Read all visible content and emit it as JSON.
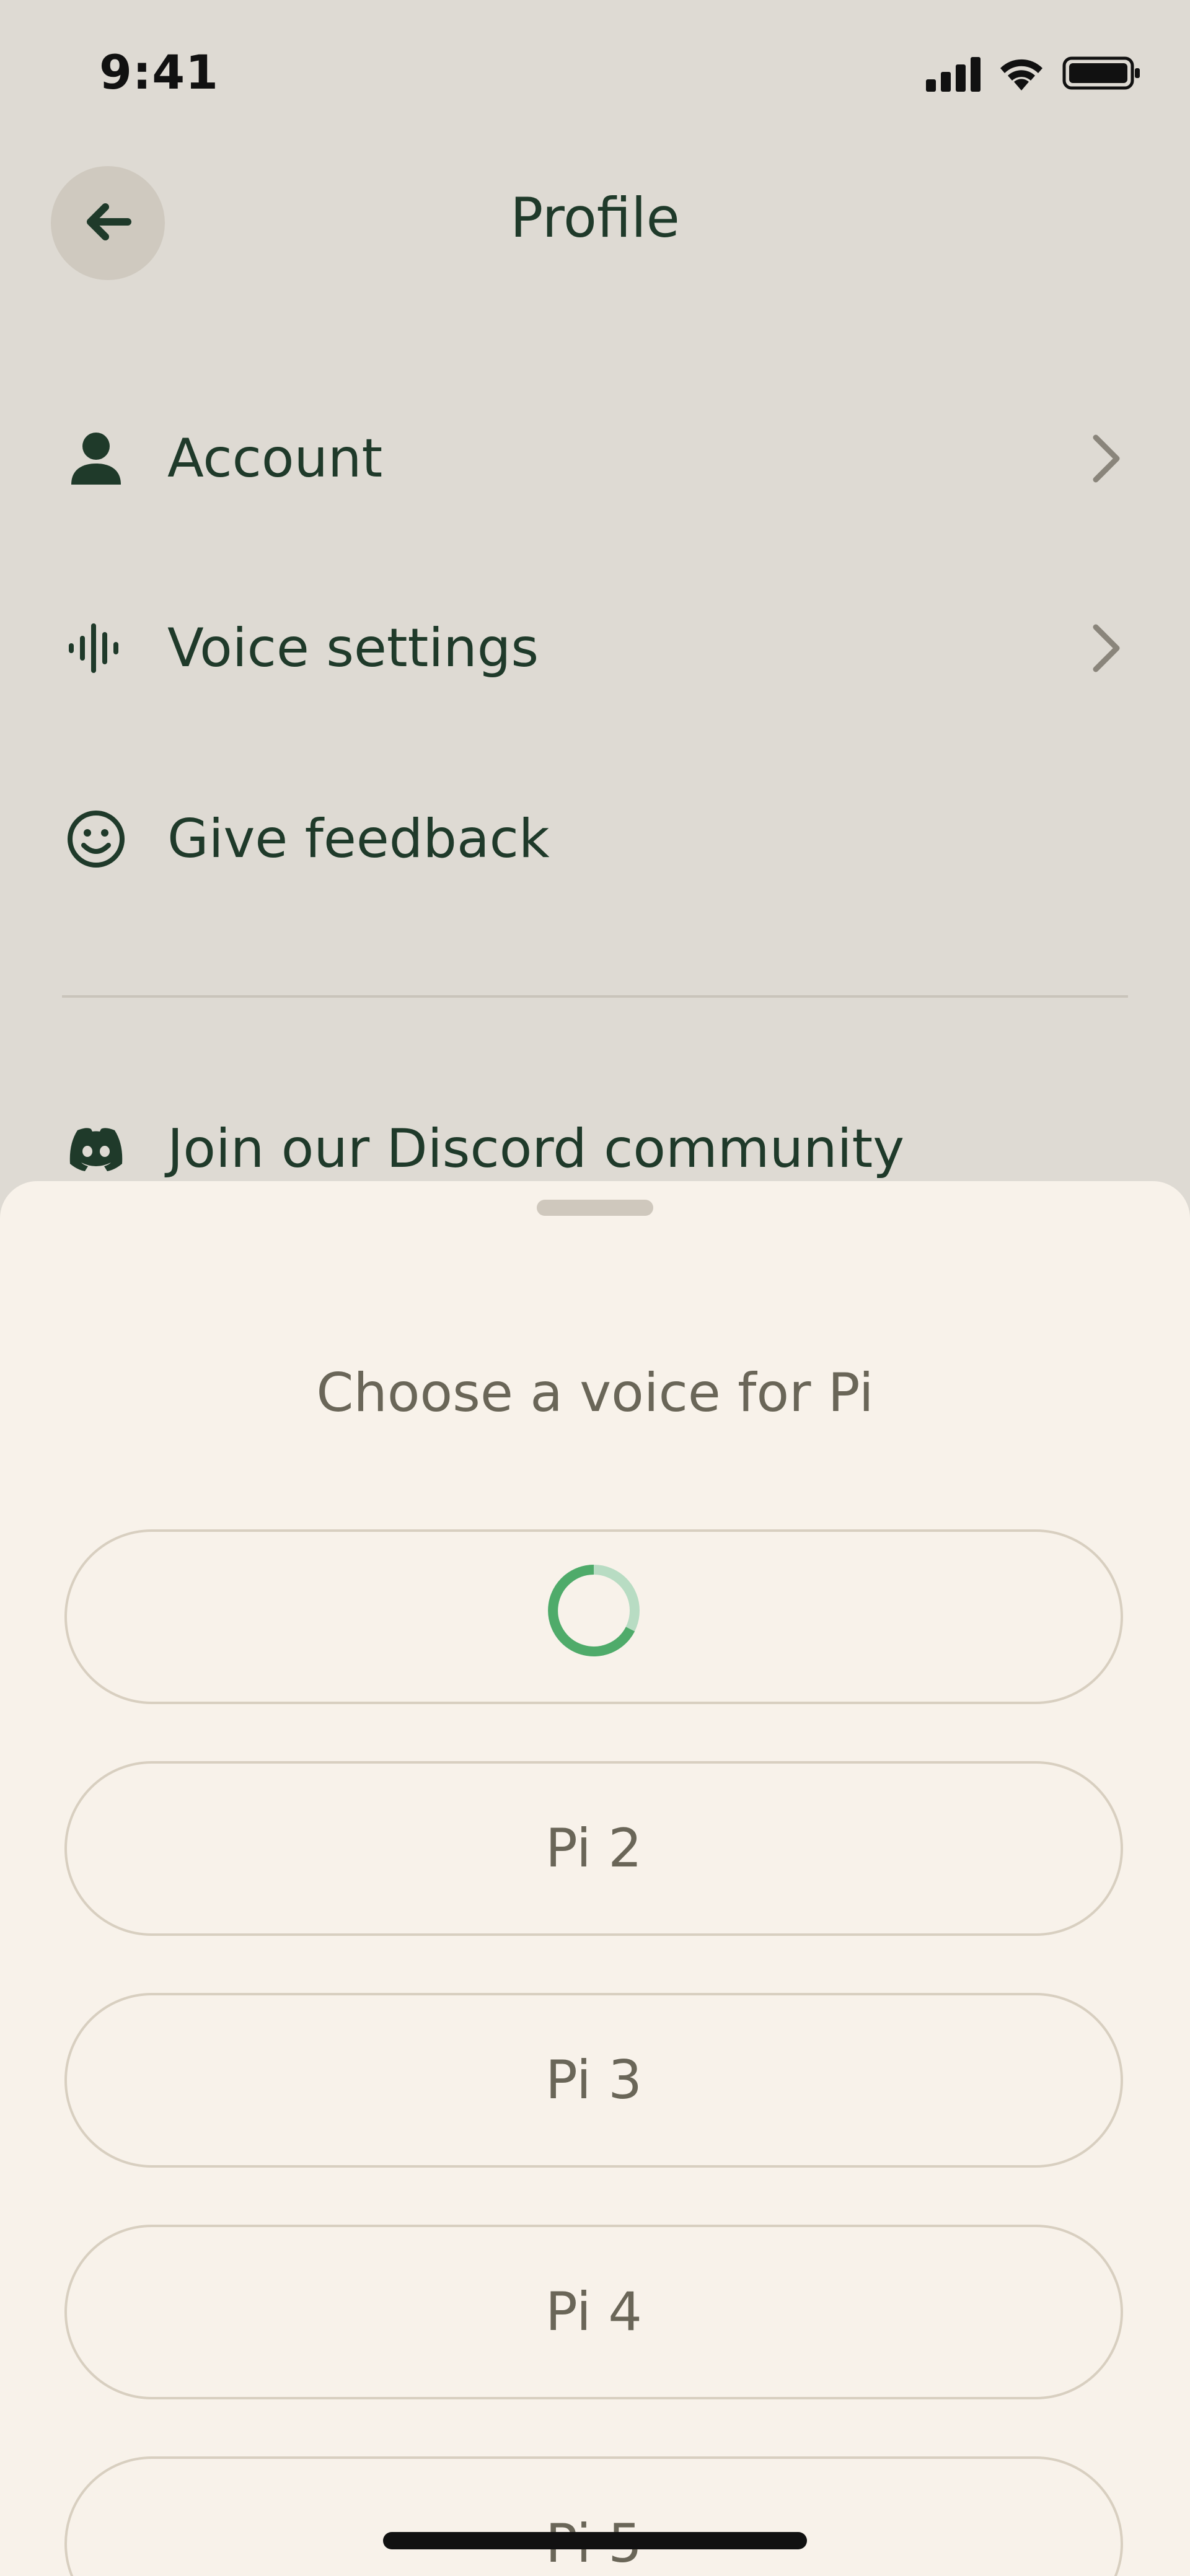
{
  "status_bar": {
    "time": "9:41"
  },
  "header": {
    "title": "Profile",
    "back_icon": "arrow-left-icon"
  },
  "menu": {
    "items": [
      {
        "label": "Account",
        "icon": "person-icon",
        "has_chevron": true
      },
      {
        "label": "Voice settings",
        "icon": "audio-waveform-icon",
        "has_chevron": true
      },
      {
        "label": "Give feedback",
        "icon": "smiley-icon",
        "has_chevron": false
      },
      {
        "label": "Join our Discord community",
        "icon": "discord-icon",
        "has_chevron": false
      }
    ]
  },
  "sheet": {
    "title": "Choose a voice for Pi",
    "options": [
      {
        "label": "",
        "state": "loading"
      },
      {
        "label": "Pi 2"
      },
      {
        "label": "Pi 3"
      },
      {
        "label": "Pi 4"
      },
      {
        "label": "Pi 5"
      }
    ]
  },
  "colors": {
    "background": "#dedad3",
    "sheet_background": "#f8f2ea",
    "text_primary": "#1f3a2a",
    "text_secondary": "#6a6658",
    "spinner": "#4fab6a",
    "spinner_track": "#b8dcc3"
  }
}
